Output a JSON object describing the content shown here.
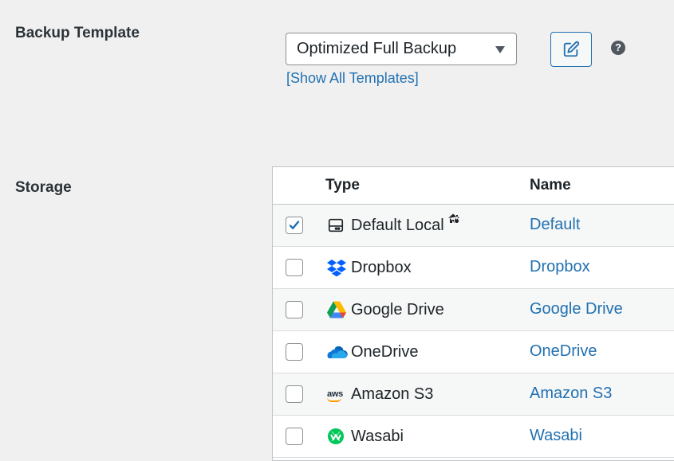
{
  "backup_template": {
    "label": "Backup Template",
    "selected": "Optimized Full Backup",
    "show_all_link": "[Show All Templates]",
    "help_glyph": "?",
    "edit_icon": "edit-pencil-icon"
  },
  "storage": {
    "label": "Storage",
    "columns": {
      "type": "Type",
      "name": "Name"
    },
    "rows": [
      {
        "type": "Default Local",
        "name": "Default",
        "checked": true,
        "icon": "hard-drive-icon"
      },
      {
        "type": "Dropbox",
        "name": "Dropbox",
        "checked": false,
        "icon": "dropbox-icon"
      },
      {
        "type": "Google Drive",
        "name": "Google Drive",
        "checked": false,
        "icon": "google-drive-icon"
      },
      {
        "type": "OneDrive",
        "name": "OneDrive",
        "checked": false,
        "icon": "onedrive-icon"
      },
      {
        "type": "Amazon S3",
        "name": "Amazon S3",
        "checked": false,
        "icon": "aws-icon"
      },
      {
        "type": "Wasabi",
        "name": "Wasabi",
        "checked": false,
        "icon": "wasabi-icon"
      }
    ]
  },
  "colors": {
    "link": "#2271b1",
    "background": "#f0f0f1",
    "checkmark": "#2271b1"
  },
  "aws_logo_text": "aws"
}
